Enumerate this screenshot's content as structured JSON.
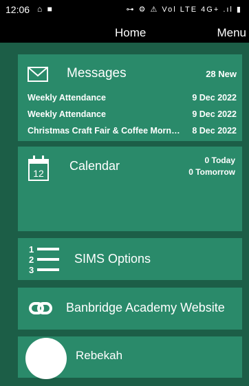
{
  "status_bar": {
    "time": "12:06",
    "left_icons": "⌂ ■",
    "right_icons": "⊶ ⚙ ⚠ Vol LTE 4G+ .ıl ▮"
  },
  "app_bar": {
    "title": "Home",
    "menu": "Menu"
  },
  "messages": {
    "title": "Messages",
    "count": "28 New",
    "items": [
      {
        "subject": "Weekly Attendance",
        "date": "9 Dec 2022"
      },
      {
        "subject": "Weekly Attendance",
        "date": "9 Dec 2022"
      },
      {
        "subject": "Christmas Craft Fair & Coffee Morning",
        "date": "8 Dec 2022"
      }
    ]
  },
  "calendar": {
    "title": "Calendar",
    "day": "12",
    "today": "0 Today",
    "tomorrow": "0 Tomorrow"
  },
  "sims": {
    "label": "SIMS Options",
    "icon_digits": [
      "1",
      "2",
      "3"
    ]
  },
  "website": {
    "label": "Banbridge Academy Website"
  },
  "profile": {
    "name": "Rebekah"
  },
  "colors": {
    "background": "#1c5e47",
    "card": "#2a8a6a",
    "bars": "#000000"
  }
}
